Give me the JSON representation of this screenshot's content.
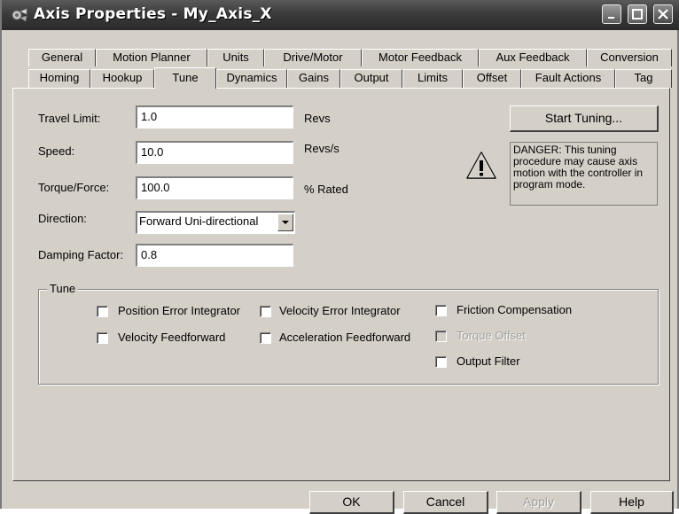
{
  "window": {
    "title": "Axis Properties - My_Axis_X"
  },
  "tabs_row1": [
    "General",
    "Motion Planner",
    "Units",
    "Drive/Motor",
    "Motor Feedback",
    "Aux Feedback",
    "Conversion"
  ],
  "tabs_row2": [
    "Homing",
    "Hookup",
    "Tune",
    "Dynamics",
    "Gains",
    "Output",
    "Limits",
    "Offset",
    "Fault Actions",
    "Tag"
  ],
  "active_tab": "Tune",
  "fields": {
    "travel_limit": {
      "label": "Travel Limit:",
      "value": "1.0",
      "unit": "Revs"
    },
    "speed": {
      "label": "Speed:",
      "value": "10.0",
      "unit": "Revs/s"
    },
    "torque_force": {
      "label": "Torque/Force:",
      "value": "100.0",
      "unit": "% Rated"
    },
    "direction": {
      "label": "Direction:",
      "value": "Forward Uni-directional"
    },
    "damping_factor": {
      "label": "Damping Factor:",
      "value": "0.8"
    }
  },
  "start_tuning_label": "Start Tuning...",
  "danger_text": "DANGER: This tuning procedure may cause axis motion with the controller in program mode.",
  "tune_group": {
    "title": "Tune",
    "checkboxes": {
      "position_error_integrator": "Position Error Integrator",
      "velocity_error_integrator": "Velocity Error Integrator",
      "friction_compensation": "Friction Compensation",
      "velocity_feedforward": "Velocity Feedforward",
      "acceleration_feedforward": "Acceleration Feedforward",
      "torque_offset": "Torque Offset",
      "output_filter": "Output Filter"
    }
  },
  "buttons": {
    "ok": "OK",
    "cancel": "Cancel",
    "apply": "Apply",
    "help": "Help"
  },
  "icons": {
    "title": "axis-properties-icon",
    "warning": "warning-icon"
  },
  "colors": {
    "title_bar": "#3b3b3b",
    "dialog_face": "#d4d0c8"
  }
}
